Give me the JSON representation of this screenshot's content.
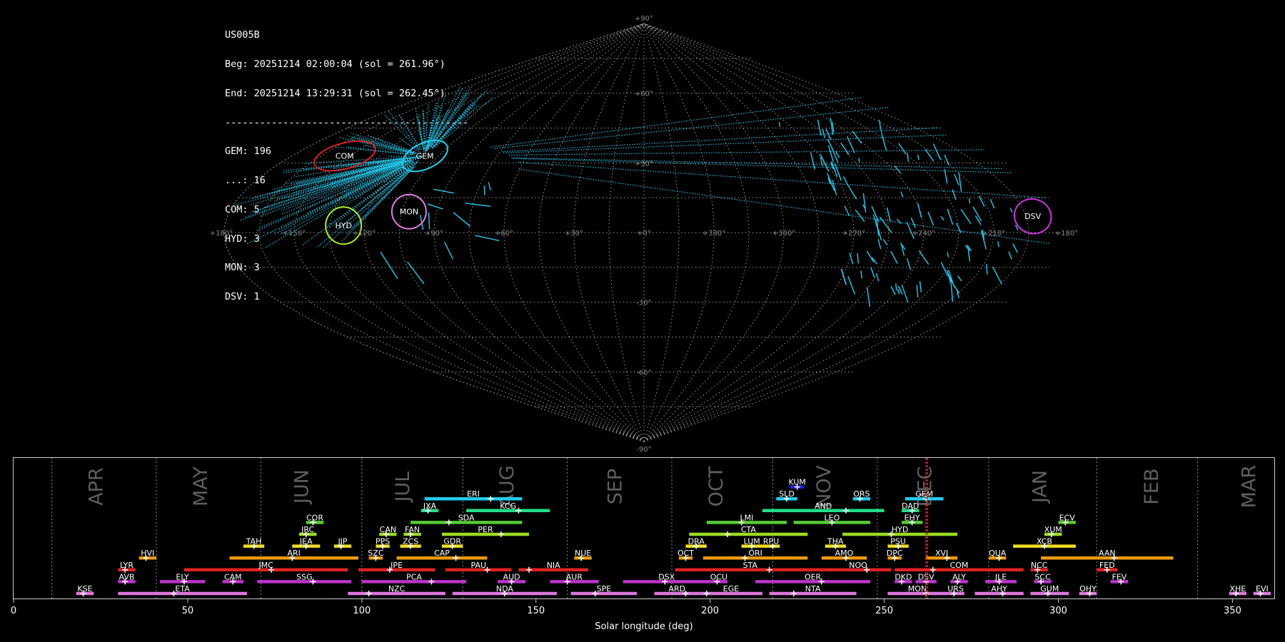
{
  "info": {
    "station": "US005B",
    "begin": "Beg: 20251214 02:00:04 (sol = 261.96°)",
    "end": "End: 20251214 13:29:31 (sol = 262.45°)",
    "separator": "------------------------------------------",
    "counts": [
      "GEM: 196",
      "...: 16",
      "COM: 5",
      "HYD: 3",
      "MON: 3",
      "DSV: 1"
    ]
  },
  "colors": {
    "background": "#000000",
    "meteor": "#22ccee",
    "grid": "#9a9a9a",
    "frame": "#cccccc",
    "sol_marker": "#ff2020"
  },
  "chart_data": [
    {
      "type": "scatter",
      "projection": "sinusoidal",
      "description_lon_labels": [
        "+180°",
        "+150°",
        "+120°",
        "+90°",
        "+60°",
        "+30°",
        "+0°",
        "+330°",
        "+300°",
        "+270°",
        "+240°",
        "+210°",
        "+180°"
      ],
      "lon_label_values": [
        180,
        150,
        120,
        90,
        60,
        30,
        0,
        330,
        300,
        270,
        240,
        210,
        180
      ],
      "lat_labels": [
        "+90°",
        "+60°",
        "+30°",
        "-30°",
        "-60°",
        "-90°"
      ],
      "lat_label_values": [
        90,
        60,
        30,
        -30,
        -60,
        -90
      ],
      "radiants": [
        {
          "name": "GEM",
          "lon": 112,
          "lat": 33,
          "color": "#22ccee"
        },
        {
          "name": "COM",
          "lon": 153,
          "lat": 33,
          "color": "#d62020"
        },
        {
          "name": "MON",
          "lon": 102,
          "lat": 9,
          "color": "#e27ce2"
        },
        {
          "name": "HYD",
          "lon": 129,
          "lat": 3,
          "color": "#aaee22"
        },
        {
          "name": "DSV",
          "lon": 192,
          "lat": 7,
          "color": "#cc33dd"
        }
      ],
      "grid": true
    },
    {
      "type": "bar",
      "xlabel": "Solar longitude (deg)",
      "xlim": [
        0,
        362
      ],
      "xticks": [
        0,
        50,
        100,
        150,
        200,
        250,
        300,
        350
      ],
      "current_sol": [
        261.96,
        262.45
      ],
      "months": [
        {
          "name": "APR",
          "at": 24,
          "sep": 11
        },
        {
          "name": "MAY",
          "at": 54,
          "sep": 41
        },
        {
          "name": "JUN",
          "at": 83,
          "sep": 71
        },
        {
          "name": "JUL",
          "at": 112,
          "sep": 100
        },
        {
          "name": "AUG",
          "at": 142,
          "sep": 129
        },
        {
          "name": "SEP",
          "at": 173,
          "sep": 159
        },
        {
          "name": "OCT",
          "at": 202,
          "sep": 189
        },
        {
          "name": "NOV",
          "at": 233,
          "sep": 218
        },
        {
          "name": "DEC",
          "at": 262,
          "sep": 248
        },
        {
          "name": "JAN",
          "at": 295,
          "sep": 280
        },
        {
          "name": "FEB",
          "at": 327,
          "sep": 311
        },
        {
          "name": "MAR",
          "at": 355,
          "sep": 340
        }
      ],
      "showers": [
        {
          "code": "KUM",
          "start": 223,
          "end": 227,
          "peak": 225,
          "row": 9,
          "color": "#2020ee"
        },
        {
          "code": "ERI",
          "start": 118,
          "end": 146,
          "peak": 137,
          "row": 8,
          "color": "#22ccee"
        },
        {
          "code": "SLD",
          "start": 219,
          "end": 225,
          "peak": 222,
          "row": 8,
          "color": "#22ccee"
        },
        {
          "code": "ORS",
          "start": 241,
          "end": 246,
          "peak": 243,
          "row": 8,
          "color": "#22ccee"
        },
        {
          "code": "GEM",
          "start": 256,
          "end": 267,
          "peak": 262,
          "row": 8,
          "color": "#22ccee"
        },
        {
          "code": "JXA",
          "start": 117,
          "end": 122,
          "peak": 119,
          "row": 7,
          "color": "#22dd88"
        },
        {
          "code": "KCG",
          "start": 130,
          "end": 154,
          "peak": 145,
          "row": 7,
          "color": "#22dd88"
        },
        {
          "code": "AND",
          "start": 215,
          "end": 250,
          "peak": 239,
          "row": 7,
          "color": "#22dd88"
        },
        {
          "code": "DAD",
          "start": 255,
          "end": 260,
          "peak": 258,
          "row": 7,
          "color": "#22dd88"
        },
        {
          "code": "COR",
          "start": 84,
          "end": 89,
          "peak": 86,
          "row": 6,
          "color": "#55cc33"
        },
        {
          "code": "SDA",
          "start": 114,
          "end": 146,
          "peak": 125,
          "row": 6,
          "color": "#55cc33"
        },
        {
          "code": "LMI",
          "start": 199,
          "end": 222,
          "peak": 209,
          "row": 6,
          "color": "#55cc33"
        },
        {
          "code": "LEO",
          "start": 224,
          "end": 246,
          "peak": 235,
          "row": 6,
          "color": "#55cc33"
        },
        {
          "code": "EHY",
          "start": 255,
          "end": 261,
          "peak": 258,
          "row": 6,
          "color": "#55cc33"
        },
        {
          "code": "ECV",
          "start": 300,
          "end": 305,
          "peak": 302,
          "row": 6,
          "color": "#55cc33"
        },
        {
          "code": "JRC",
          "start": 82,
          "end": 87,
          "peak": 84,
          "row": 5,
          "color": "#99dd22"
        },
        {
          "code": "CAN",
          "start": 105,
          "end": 110,
          "peak": 107,
          "row": 5,
          "color": "#99dd22"
        },
        {
          "code": "FAN",
          "start": 112,
          "end": 117,
          "peak": 114,
          "row": 5,
          "color": "#99dd22"
        },
        {
          "code": "PER",
          "start": 123,
          "end": 148,
          "peak": 140,
          "row": 5,
          "color": "#99dd22"
        },
        {
          "code": "CTA",
          "start": 194,
          "end": 228,
          "peak": 205,
          "row": 5,
          "color": "#99dd22"
        },
        {
          "code": "HYD",
          "start": 238,
          "end": 271,
          "peak": 252,
          "row": 5,
          "color": "#99dd22"
        },
        {
          "code": "XUM",
          "start": 296,
          "end": 301,
          "peak": 298,
          "row": 5,
          "color": "#99dd22"
        },
        {
          "code": "TAH",
          "start": 66,
          "end": 72,
          "peak": 69,
          "row": 4,
          "color": "#eedd22"
        },
        {
          "code": "JEA",
          "start": 80,
          "end": 88,
          "peak": 84,
          "row": 4,
          "color": "#eedd22"
        },
        {
          "code": "JIP",
          "start": 92,
          "end": 97,
          "peak": 94,
          "row": 4,
          "color": "#eedd22"
        },
        {
          "code": "PPS",
          "start": 104,
          "end": 108,
          "peak": 106,
          "row": 4,
          "color": "#eedd22"
        },
        {
          "code": "ZCS",
          "start": 111,
          "end": 117,
          "peak": 114,
          "row": 4,
          "color": "#eedd22"
        },
        {
          "code": "GDR",
          "start": 123,
          "end": 129,
          "peak": 126,
          "row": 4,
          "color": "#eedd22"
        },
        {
          "code": "DRA",
          "start": 193,
          "end": 199,
          "peak": 196,
          "row": 4,
          "color": "#eedd22"
        },
        {
          "code": "LUM",
          "start": 209,
          "end": 215,
          "peak": 212,
          "row": 4,
          "color": "#eedd22"
        },
        {
          "code": "RPU",
          "start": 215,
          "end": 220,
          "peak": 218,
          "row": 4,
          "color": "#eedd22"
        },
        {
          "code": "THA",
          "start": 233,
          "end": 239,
          "peak": 236,
          "row": 4,
          "color": "#eedd22"
        },
        {
          "code": "PSU",
          "start": 251,
          "end": 257,
          "peak": 254,
          "row": 4,
          "color": "#eedd22"
        },
        {
          "code": "XCB",
          "start": 287,
          "end": 305,
          "peak": 296,
          "row": 4,
          "color": "#eedd22"
        },
        {
          "code": "HVI",
          "start": 36,
          "end": 41,
          "peak": 38,
          "row": 3,
          "color": "#ee9911"
        },
        {
          "code": "ARI",
          "start": 62,
          "end": 99,
          "peak": 80,
          "row": 3,
          "color": "#ee9911"
        },
        {
          "code": "SZC",
          "start": 102,
          "end": 106,
          "peak": 104,
          "row": 3,
          "color": "#ee9911"
        },
        {
          "code": "CAP",
          "start": 110,
          "end": 136,
          "peak": 127,
          "row": 3,
          "color": "#ee9911"
        },
        {
          "code": "NUE",
          "start": 161,
          "end": 166,
          "peak": 163,
          "row": 3,
          "color": "#ee9911"
        },
        {
          "code": "OCT",
          "start": 191,
          "end": 195,
          "peak": 193,
          "row": 3,
          "color": "#ee9911"
        },
        {
          "code": "ORI",
          "start": 198,
          "end": 228,
          "peak": 210,
          "row": 3,
          "color": "#ee9911"
        },
        {
          "code": "AMO",
          "start": 232,
          "end": 245,
          "peak": 239,
          "row": 3,
          "color": "#ee9911"
        },
        {
          "code": "DPC",
          "start": 251,
          "end": 255,
          "peak": 253,
          "row": 3,
          "color": "#ee9911"
        },
        {
          "code": "XVI",
          "start": 262,
          "end": 271,
          "peak": 268,
          "row": 3,
          "color": "#ee9911"
        },
        {
          "code": "QUA",
          "start": 280,
          "end": 285,
          "peak": 283,
          "row": 3,
          "color": "#ee9911"
        },
        {
          "code": "AAN",
          "start": 295,
          "end": 333,
          "peak": 316,
          "row": 3,
          "color": "#ee9911"
        },
        {
          "code": "LYR",
          "start": 30,
          "end": 35,
          "peak": 32,
          "row": 2,
          "color": "#dd2222"
        },
        {
          "code": "JMC",
          "start": 49,
          "end": 96,
          "peak": 74,
          "row": 2,
          "color": "#dd2222"
        },
        {
          "code": "JPE",
          "start": 99,
          "end": 121,
          "peak": 108,
          "row": 2,
          "color": "#dd2222"
        },
        {
          "code": "PAU",
          "start": 124,
          "end": 143,
          "peak": 136,
          "row": 2,
          "color": "#dd2222"
        },
        {
          "code": "NIA",
          "start": 145,
          "end": 165,
          "peak": 148,
          "row": 2,
          "color": "#dd2222"
        },
        {
          "code": "STA",
          "start": 190,
          "end": 233,
          "peak": 217,
          "row": 2,
          "color": "#dd2222"
        },
        {
          "code": "NOO",
          "start": 233,
          "end": 252,
          "peak": 245,
          "row": 2,
          "color": "#dd2222"
        },
        {
          "code": "COM",
          "start": 253,
          "end": 290,
          "peak": 264,
          "row": 2,
          "color": "#dd2222"
        },
        {
          "code": "NCC",
          "start": 292,
          "end": 297,
          "peak": 294,
          "row": 2,
          "color": "#dd2222"
        },
        {
          "code": "FED",
          "start": 311,
          "end": 317,
          "peak": 314,
          "row": 2,
          "color": "#dd2222"
        },
        {
          "code": "AVB",
          "start": 30,
          "end": 35,
          "peak": 32,
          "row": 1,
          "color": "#bb33cc"
        },
        {
          "code": "ELY",
          "start": 42,
          "end": 55,
          "peak": 49,
          "row": 1,
          "color": "#bb33cc"
        },
        {
          "code": "CAM",
          "start": 60,
          "end": 66,
          "peak": 63,
          "row": 1,
          "color": "#bb33cc"
        },
        {
          "code": "SSG",
          "start": 70,
          "end": 97,
          "peak": 86,
          "row": 1,
          "color": "#bb33cc"
        },
        {
          "code": "PCA",
          "start": 100,
          "end": 130,
          "peak": 120,
          "row": 1,
          "color": "#bb33cc"
        },
        {
          "code": "AUD",
          "start": 139,
          "end": 147,
          "peak": 143,
          "row": 1,
          "color": "#bb33cc"
        },
        {
          "code": "AUR",
          "start": 154,
          "end": 168,
          "peak": 159,
          "row": 1,
          "color": "#bb33cc"
        },
        {
          "code": "DSX",
          "start": 175,
          "end": 200,
          "peak": 187,
          "row": 1,
          "color": "#bb33cc"
        },
        {
          "code": "OCU",
          "start": 200,
          "end": 205,
          "peak": 202,
          "row": 1,
          "color": "#bb33cc"
        },
        {
          "code": "OER",
          "start": 213,
          "end": 246,
          "peak": 232,
          "row": 1,
          "color": "#bb33cc"
        },
        {
          "code": "DKD",
          "start": 253,
          "end": 258,
          "peak": 255,
          "row": 1,
          "color": "#bb33cc"
        },
        {
          "code": "DSV",
          "start": 259,
          "end": 265,
          "peak": 262,
          "row": 1,
          "color": "#bb33cc"
        },
        {
          "code": "ALY",
          "start": 269,
          "end": 274,
          "peak": 271,
          "row": 1,
          "color": "#bb33cc"
        },
        {
          "code": "JLE",
          "start": 279,
          "end": 288,
          "peak": 283,
          "row": 1,
          "color": "#bb33cc"
        },
        {
          "code": "SCC",
          "start": 293,
          "end": 298,
          "peak": 295,
          "row": 1,
          "color": "#bb33cc"
        },
        {
          "code": "FEV",
          "start": 315,
          "end": 320,
          "peak": 318,
          "row": 1,
          "color": "#bb33cc"
        },
        {
          "code": "KSE",
          "start": 18,
          "end": 23,
          "peak": 20,
          "row": 0,
          "color": "#dd77dd"
        },
        {
          "code": "ETA",
          "start": 30,
          "end": 67,
          "peak": 46,
          "row": 0,
          "color": "#dd77dd"
        },
        {
          "code": "NZC",
          "start": 96,
          "end": 124,
          "peak": 102,
          "row": 0,
          "color": "#dd77dd"
        },
        {
          "code": "NDA",
          "start": 126,
          "end": 156,
          "peak": 141,
          "row": 0,
          "color": "#dd77dd"
        },
        {
          "code": "SPE",
          "start": 160,
          "end": 179,
          "peak": 167,
          "row": 0,
          "color": "#dd77dd"
        },
        {
          "code": "ARD",
          "start": 184,
          "end": 197,
          "peak": 193,
          "row": 0,
          "color": "#dd77dd"
        },
        {
          "code": "EGE",
          "start": 197,
          "end": 215,
          "peak": 199,
          "row": 0,
          "color": "#dd77dd"
        },
        {
          "code": "NTA",
          "start": 217,
          "end": 242,
          "peak": 224,
          "row": 0,
          "color": "#dd77dd"
        },
        {
          "code": "MON",
          "start": 251,
          "end": 268,
          "peak": 262,
          "row": 0,
          "color": "#dd77dd"
        },
        {
          "code": "URS",
          "start": 268,
          "end": 273,
          "peak": 270,
          "row": 0,
          "color": "#dd77dd"
        },
        {
          "code": "AHY",
          "start": 276,
          "end": 290,
          "peak": 284,
          "row": 0,
          "color": "#dd77dd"
        },
        {
          "code": "GUM",
          "start": 292,
          "end": 303,
          "peak": 297,
          "row": 0,
          "color": "#dd77dd"
        },
        {
          "code": "OHY",
          "start": 306,
          "end": 311,
          "peak": 309,
          "row": 0,
          "color": "#dd77dd"
        },
        {
          "code": "XHE",
          "start": 349,
          "end": 354,
          "peak": 351,
          "row": 0,
          "color": "#dd77dd"
        },
        {
          "code": "EVI",
          "start": 356,
          "end": 361,
          "peak": 358,
          "row": 0,
          "color": "#dd77dd"
        }
      ]
    }
  ]
}
